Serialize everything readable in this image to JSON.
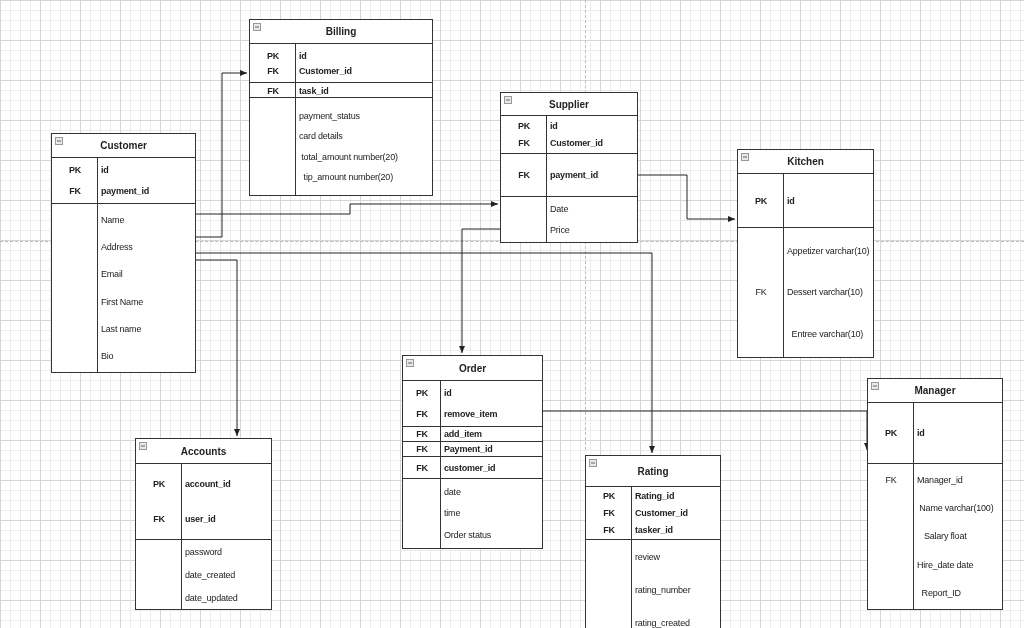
{
  "diagram": {
    "tables": [
      {
        "title": "Billing",
        "sections": [
          {
            "kind": "keys",
            "rows": [
              {
                "key": "PK",
                "field": "id"
              },
              {
                "key": "FK",
                "field": "Customer_id"
              }
            ]
          },
          {
            "kind": "keys",
            "rows": [
              {
                "key": "FK",
                "field": "task_id"
              }
            ]
          },
          {
            "kind": "attributes",
            "rows": [
              {
                "field": "payment_status"
              },
              {
                "field": "card details"
              },
              {
                "field": " total_amount number(20)"
              },
              {
                "field": "  tip_amount number(20)"
              }
            ]
          }
        ]
      },
      {
        "title": "Customer",
        "sections": [
          {
            "kind": "keys",
            "rows": [
              {
                "key": "PK",
                "field": "id"
              },
              {
                "key": "FK",
                "field": "payment_id"
              }
            ]
          },
          {
            "kind": "attributes",
            "rows": [
              {
                "field": "Name"
              },
              {
                "field": "Address"
              },
              {
                "field": "Email"
              },
              {
                "field": "First Name"
              },
              {
                "field": "Last name"
              },
              {
                "field": "Bio"
              }
            ]
          }
        ]
      },
      {
        "title": "Supplier",
        "sections": [
          {
            "kind": "keys",
            "rows": [
              {
                "key": "PK",
                "field": "id"
              },
              {
                "key": "FK",
                "field": "Customer_id"
              }
            ]
          },
          {
            "kind": "keys",
            "rows": [
              {
                "key": "FK",
                "field": "payment_id"
              }
            ]
          },
          {
            "kind": "attributes",
            "rows": [
              {
                "field": "Date"
              },
              {
                "field": "Price"
              }
            ]
          }
        ]
      },
      {
        "title": "Kitchen",
        "sections": [
          {
            "kind": "keys",
            "rows": [
              {
                "key": "PK",
                "field": "id"
              }
            ]
          },
          {
            "kind": "attributes",
            "rows": [
              {
                "field": "Appetizer varchar(10)"
              },
              {
                "key": "FK",
                "field": "Dessert varchar(10)"
              },
              {
                "field": "  Entree varchar(10)"
              }
            ]
          }
        ]
      },
      {
        "title": "Order",
        "sections": [
          {
            "kind": "keys",
            "rows": [
              {
                "key": "PK",
                "field": "id"
              },
              {
                "key": "FK",
                "field": "remove_item"
              }
            ]
          },
          {
            "kind": "keys",
            "rows": [
              {
                "key": "FK",
                "field": "add_item"
              }
            ]
          },
          {
            "kind": "keys",
            "rows": [
              {
                "key": "FK",
                "field": "Payment_id"
              }
            ]
          },
          {
            "kind": "keys",
            "rows": [
              {
                "key": "FK",
                "field": "customer_id"
              }
            ]
          },
          {
            "kind": "attributes",
            "rows": [
              {
                "field": "date"
              },
              {
                "field": "time"
              },
              {
                "field": "Order status"
              }
            ]
          }
        ]
      },
      {
        "title": "Accounts",
        "sections": [
          {
            "kind": "keys",
            "rows": [
              {
                "key": "PK",
                "field": "account_id"
              },
              {
                "key": "FK",
                "field": "user_id"
              }
            ]
          },
          {
            "kind": "attributes",
            "rows": [
              {
                "field": "password"
              },
              {
                "field": "date_created"
              },
              {
                "field": "date_updated"
              }
            ]
          }
        ]
      },
      {
        "title": "Rating",
        "sections": [
          {
            "kind": "keys",
            "rows": [
              {
                "key": "PK",
                "field": "Rating_id"
              },
              {
                "key": "FK",
                "field": "Customer_id"
              },
              {
                "key": "FK",
                "field": "tasker_id"
              }
            ]
          },
          {
            "kind": "attributes",
            "rows": [
              {
                "field": "review"
              },
              {
                "field": "rating_number"
              },
              {
                "field": "rating_created"
              }
            ]
          }
        ]
      },
      {
        "title": "Manager",
        "sections": [
          {
            "kind": "keys",
            "rows": [
              {
                "key": "PK",
                "field": "id"
              }
            ]
          },
          {
            "kind": "attributes",
            "rows": [
              {
                "key": "FK",
                "field": "Manager_id"
              },
              {
                "field": " Name varchar(100)"
              },
              {
                "field": "   Salary float"
              },
              {
                "field": "Hire_date date"
              },
              {
                "field": "  Report_ID"
              }
            ]
          }
        ]
      }
    ]
  }
}
